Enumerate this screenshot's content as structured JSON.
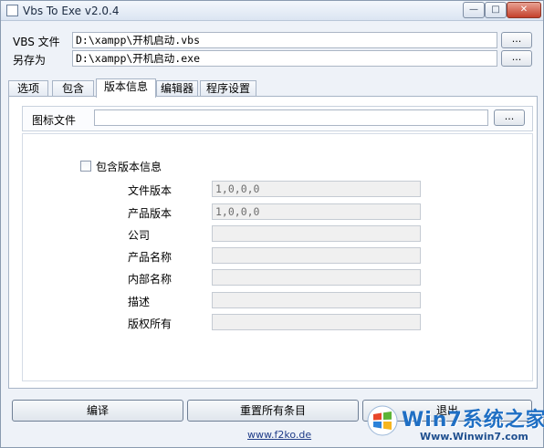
{
  "window": {
    "title": "Vbs To Exe v2.0.4",
    "min_glyph": "—",
    "max_glyph": "□",
    "close_glyph": "✕"
  },
  "vbs_file": {
    "label": "VBS 文件",
    "value": "D:\\xampp\\开机启动.vbs",
    "browse_label": "..."
  },
  "save_as": {
    "label": "另存为",
    "value": "D:\\xampp\\开机启动.exe",
    "browse_label": "..."
  },
  "tabs": [
    {
      "label": "选项"
    },
    {
      "label": "包含"
    },
    {
      "label": "版本信息"
    },
    {
      "label": "编辑器"
    },
    {
      "label": "程序设置"
    }
  ],
  "active_tab": "版本信息",
  "icon_file": {
    "label": "图标文件",
    "value": "",
    "browse_label": "..."
  },
  "version_info": {
    "include_label": "包含版本信息",
    "include_checked": false,
    "fields": [
      {
        "label": "文件版本",
        "value": "1,0,0,0"
      },
      {
        "label": "产品版本",
        "value": "1,0,0,0"
      },
      {
        "label": "公司",
        "value": ""
      },
      {
        "label": "产品名称",
        "value": ""
      },
      {
        "label": "内部名称",
        "value": ""
      },
      {
        "label": "描述",
        "value": ""
      },
      {
        "label": "版权所有",
        "value": ""
      }
    ]
  },
  "buttons": {
    "compile": "编译",
    "reset": "重置所有条目",
    "exit": "退出"
  },
  "footer_link": "www.f2ko.de",
  "watermark": {
    "text": "Win7系统之家",
    "sub": "Www.Winwin7.com"
  },
  "colors": {
    "accent": "#1f6fc4",
    "panel": "#eef2f8"
  }
}
